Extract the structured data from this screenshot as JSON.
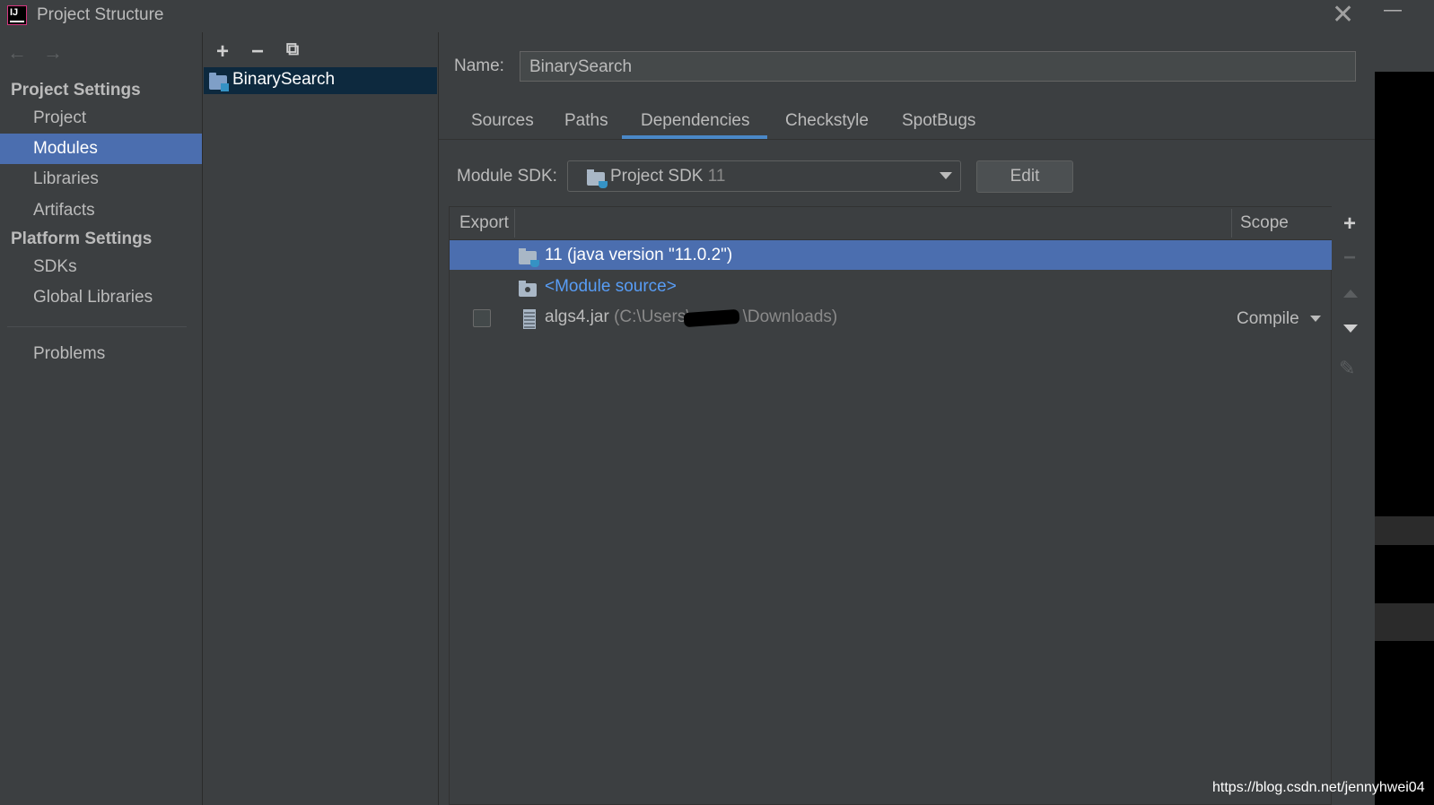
{
  "window": {
    "title": "Project Structure",
    "app_icon_text": "IJ"
  },
  "nav": {
    "back": "←",
    "forward": "→"
  },
  "sidebar": {
    "project_settings_label": "Project Settings",
    "project_items": [
      {
        "label": "Project"
      },
      {
        "label": "Modules",
        "selected": true
      },
      {
        "label": "Libraries"
      },
      {
        "label": "Artifacts"
      }
    ],
    "platform_settings_label": "Platform Settings",
    "platform_items": [
      {
        "label": "SDKs"
      },
      {
        "label": "Global Libraries"
      }
    ],
    "problems_label": "Problems"
  },
  "modules": {
    "toolbar": {
      "add": "+",
      "remove": "−",
      "copy": "⧉"
    },
    "items": [
      {
        "label": "BinarySearch",
        "selected": true
      }
    ]
  },
  "main": {
    "name_label": "Name:",
    "name_value": "BinarySearch",
    "tabs": [
      {
        "label": "Sources"
      },
      {
        "label": "Paths"
      },
      {
        "label": "Dependencies",
        "active": true
      },
      {
        "label": "Checkstyle"
      },
      {
        "label": "SpotBugs"
      }
    ],
    "module_sdk_label": "Module SDK:",
    "module_sdk_value": "Project SDK",
    "module_sdk_version": "11",
    "edit_label": "Edit",
    "table": {
      "columns": {
        "export": "Export",
        "scope": "Scope"
      },
      "rows": [
        {
          "name": "11 (java version \"11.0.2\")",
          "selected": true,
          "icon": "jdk-folder-icon"
        },
        {
          "name": "<Module source>",
          "icon": "module-source-folder-icon"
        },
        {
          "name": "algs4.jar",
          "path_prefix": "(C:\\Users\\",
          "path_suffix": "\\Downloads)",
          "scope": "Compile",
          "exported": false,
          "icon": "jar-icon"
        }
      ]
    },
    "actions": {
      "add": "+",
      "remove": "−"
    }
  },
  "outside": {
    "minimize": "—"
  },
  "watermark": "https://blog.csdn.net/jennyhwei04",
  "colors": {
    "background": "#3c3f41",
    "selection": "#4b6eaf",
    "accent_tab": "#4a88c7",
    "link": "#589df6"
  }
}
